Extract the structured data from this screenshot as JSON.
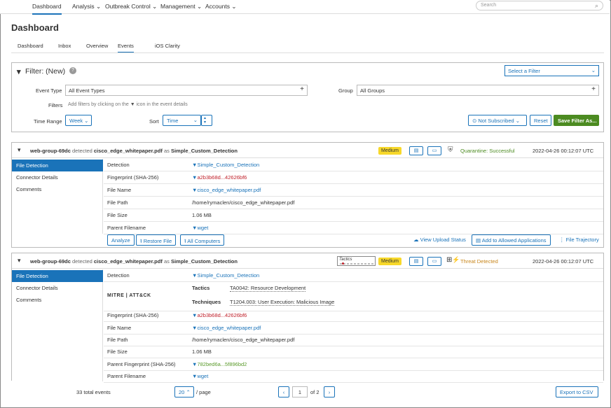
{
  "nav": {
    "items": [
      "Dashboard",
      "Analysis",
      "Outbreak Control",
      "Management",
      "Accounts"
    ],
    "search_placeholder": "Search"
  },
  "page": {
    "title": "Dashboard"
  },
  "tabs": [
    "Dashboard",
    "Inbox",
    "Overview",
    "Events",
    "iOS Clarity"
  ],
  "filter": {
    "title": "Filter: (New)",
    "select_filter": "Select a Filter",
    "event_type_label": "Event Type",
    "event_type_value": "All Event Types",
    "group_label": "Group",
    "group_value": "All Groups",
    "filters_label": "Filters",
    "filters_hint": "Add filters by clicking on the",
    "filters_hint2": "icon in the event details",
    "time_range_label": "Time Range",
    "time_range_value": "Week",
    "sort_label": "Sort",
    "sort_value": "Time",
    "not_subscribed": "Not Subscribed",
    "reset": "Reset",
    "save": "Save Filter As..."
  },
  "event1": {
    "host": "web-group-69dc",
    "detected": "detected",
    "file": "cisco_edge_whitepaper.pdf",
    "as": "as",
    "detection": "Simple_Custom_Detection",
    "severity": "Medium",
    "status": "Quarantine: Successful",
    "time": "2022-04-26 00:12:07 UTC",
    "side": [
      "File Detection",
      "Connector Details",
      "Comments"
    ],
    "rows": [
      [
        "Detection",
        "Simple_Custom_Detection"
      ],
      [
        "Fingerprint (SHA-256)",
        "a2b3b68d...42626bf6"
      ],
      [
        "File Name",
        "cisco_edge_whitepaper.pdf"
      ],
      [
        "File Path",
        "/home/rymaclen/cisco_edge_whitepaper.pdf"
      ],
      [
        "File Size",
        "1.06 MB"
      ],
      [
        "Parent Filename",
        "wget"
      ]
    ],
    "actions": {
      "analyze": "Analyze",
      "restore": "Restore File",
      "all_computers": "All Computers",
      "upload": "View Upload Status",
      "allowed": "Add to Allowed Applications",
      "trajectory": "File Trajectory"
    }
  },
  "event2": {
    "host": "web-group-69dc",
    "detected": "detected",
    "file": "cisco_edge_whitepaper.pdf",
    "as": "as",
    "detection": "Simple_Custom_Detection",
    "tactics_box": "Tactics",
    "severity": "Medium",
    "status": "Threat Detected",
    "time": "2022-04-26 00:12:07 UTC",
    "side": [
      "File Detection",
      "Connector Details",
      "Comments"
    ],
    "mitre": "MITRE | ATT&CK",
    "tactics_label": "Tactics",
    "tactics_value": "TA0042: Resource Development",
    "techniques_label": "Techniques",
    "techniques_value": "T1204.003: User Execution: Malicious Image",
    "rows": [
      [
        "Detection",
        "Simple_Custom_Detection"
      ],
      [
        "Fingerprint (SHA-256)",
        "a2b3b68d...42626bf6"
      ],
      [
        "File Name",
        "cisco_edge_whitepaper.pdf"
      ],
      [
        "File Path",
        "/home/rymaclen/cisco_edge_whitepaper.pdf"
      ],
      [
        "File Size",
        "1.06 MB"
      ],
      [
        "Parent Fingerprint (SHA-256)",
        "782bed6a...5f896bd2"
      ],
      [
        "Parent Filename",
        "wget"
      ]
    ]
  },
  "pager": {
    "total": "33 total events",
    "per_page": "20",
    "per_page_suffix": "/ page",
    "page": "1",
    "of": "of 2",
    "export": "Export to CSV"
  },
  "colors": {
    "accent": "#1a73b9",
    "save": "#4c8b21",
    "badge": "#f7d82a",
    "quarantine": "#4c8b21",
    "threat": "#c8861b"
  }
}
